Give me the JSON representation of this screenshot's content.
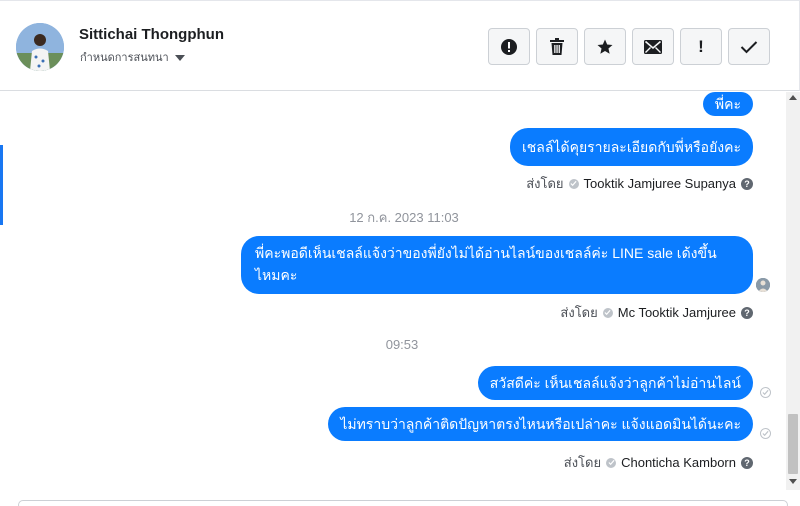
{
  "header": {
    "contact_name": "Sittichai Thongphun",
    "assign_label": "กำหนดการสนทนา"
  },
  "toolbar": {
    "buttons": [
      {
        "icon": "alert-circle-icon",
        "glyph": "!"
      },
      {
        "icon": "trash-icon"
      },
      {
        "icon": "star-icon",
        "glyph": "★"
      },
      {
        "icon": "envelope-icon"
      },
      {
        "icon": "exclamation-icon",
        "glyph": "!"
      },
      {
        "icon": "checkmark-icon",
        "glyph": "✓"
      }
    ]
  },
  "thread": {
    "group1": {
      "messages": [
        "พี่คะ",
        "เชลล์ได้คุยรายละเอียดกับพี่หรือยังคะ"
      ],
      "sent_by_label": "ส่งโดย",
      "sender": "Tooktik Jamjuree Supanya"
    },
    "timestamp1": "12 ก.ค. 2023 11:03",
    "group2": {
      "message": "พี่คะพอดีเห็นเชลล์แจ้งว่าของพี่ยังไม่ได้อ่านไลน์ของเชลล์ค่ะ LINE sale เด้งขึ้นไหมคะ",
      "sent_by_label": "ส่งโดย",
      "sender": "Mc Tooktik Jamjuree"
    },
    "timestamp2": "09:53",
    "group3": {
      "messages": [
        "สวัสดีค่ะ เห็นเชลล์แจ้งว่าลูกค้าไม่อ่านไลน์",
        "ไม่ทราบว่าลูกค้าติดปัญหาตรงไหนหรือเปล่าคะ แจ้งแอดมินได้นะคะ"
      ],
      "sent_by_label": "ส่งโดย",
      "sender": "Chonticha Kamborn"
    }
  },
  "colors": {
    "bubble": "#0a7cff",
    "accent": "#1877f2"
  }
}
